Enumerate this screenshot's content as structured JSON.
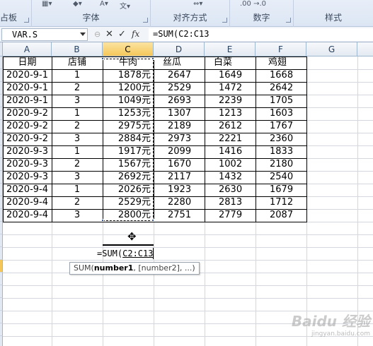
{
  "ribbon": {
    "groups": [
      {
        "label": "占板"
      },
      {
        "label": "字体"
      },
      {
        "label": "对齐方式"
      },
      {
        "label": "数字"
      },
      {
        "label": "样式"
      }
    ],
    "number_format_icons": ".00 →.0"
  },
  "formula_bar": {
    "name_box": "VAR.S",
    "cancel_icon": "✕",
    "enter_icon": "✓",
    "fx_label": "fx",
    "formula": "=SUM(C2:C13"
  },
  "columns": [
    "A",
    "B",
    "C",
    "D",
    "E",
    "F",
    "G"
  ],
  "table": {
    "headers": [
      "日期",
      "店铺",
      "牛肉",
      "丝瓜",
      "白菜",
      "鸡翅"
    ],
    "rows": [
      [
        "2020-9-1",
        "1",
        "1878元",
        "2647",
        "1649",
        "1668"
      ],
      [
        "2020-9-1",
        "2",
        "1200元",
        "2529",
        "1472",
        "2642"
      ],
      [
        "2020-9-1",
        "3",
        "1049元",
        "2693",
        "2239",
        "1705"
      ],
      [
        "2020-9-2",
        "1",
        "1253元",
        "1307",
        "1213",
        "1603"
      ],
      [
        "2020-9-2",
        "2",
        "2975元",
        "2189",
        "2612",
        "1767"
      ],
      [
        "2020-9-2",
        "3",
        "2884元",
        "2973",
        "2221",
        "2360"
      ],
      [
        "2020-9-3",
        "1",
        "1917元",
        "2099",
        "1416",
        "1833"
      ],
      [
        "2020-9-3",
        "2",
        "1567元",
        "1670",
        "1002",
        "2180"
      ],
      [
        "2020-9-3",
        "3",
        "2692元",
        "2117",
        "1432",
        "2540"
      ],
      [
        "2020-9-4",
        "1",
        "2026元",
        "1923",
        "2630",
        "1679"
      ],
      [
        "2020-9-4",
        "2",
        "2529元",
        "2280",
        "2813",
        "1712"
      ],
      [
        "2020-9-4",
        "3",
        "2800元",
        "2751",
        "2779",
        "2087"
      ]
    ]
  },
  "editing_cell": {
    "prefix": "=SUM(",
    "argument": "C2:C13"
  },
  "tooltip": {
    "fn": "SUM(",
    "arg1": "number1",
    "rest": ", [number2], ...)"
  },
  "watermark": {
    "text": "Baidu 经验",
    "sub": "jingyan.baidu.com"
  }
}
